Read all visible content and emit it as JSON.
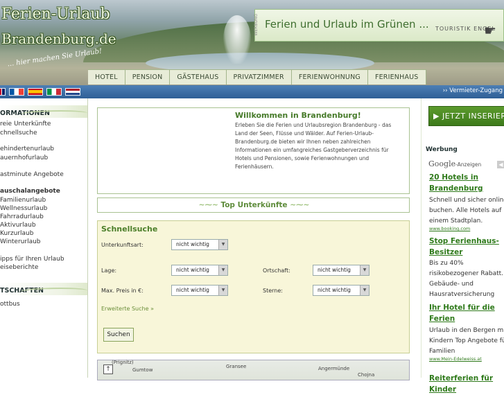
{
  "header": {
    "logo_line1": "Ferien-Urlaub",
    "logo_line2": "Brandenburg.de",
    "slogan": "... hier machen Sie Urlaub!",
    "banner_text": "Ferien und Urlaub im Grünen ...",
    "banner_brand": "TOURISTIK ENGEL",
    "banner_vertical": "WERBUNG"
  },
  "nav": [
    "HOTEL",
    "PENSION",
    "GÄSTEHAUS",
    "PRIVATZIMMER",
    "FERIENWOHNUNG",
    "FERIENHAUS"
  ],
  "langbar": {
    "vermieter": "›› Vermieter-Zugang",
    "flags": [
      "english",
      "french",
      "spanish",
      "italian",
      "dutch"
    ]
  },
  "leftnav": {
    "section_info": "ORMATIONEN",
    "items1": [
      "reie Unterkünfte",
      "chnellsuche"
    ],
    "items2": [
      "ehindertenurlaub",
      "auernhofurlaub"
    ],
    "item3": "astminute Angebote",
    "item_bold": "auschalangebote",
    "items4": [
      "Familienurlaub",
      "Wellnessurlaub",
      "Fahrradurlaub",
      "Aktivurlaub",
      "Kurzurlaub",
      "Winterurlaub"
    ],
    "items5": [
      "ipps für Ihren Urlaub",
      "eiseberichte"
    ],
    "section_places": "TSCHAFTEN",
    "items6": [
      "ottbus"
    ]
  },
  "welcome": {
    "title": "Willkommen in Brandenburg!",
    "body": "Erleben Sie die Ferien und Urlaubsregion Brandenburg - das Land der Seen, Flüsse und Wälder. Auf Ferien-Urlaub-Brandenburg.de bieten wir Ihnen neben zahlreichen Informationen ein umfangreiches Gastgeberverzeichnis für Hotels und Pensionen, sowie Ferienwohnungen und Ferienhäusern."
  },
  "top_unterkuenfte": "Top Unterkünfte",
  "search": {
    "title": "Schnellsuche",
    "label_art": "Unterkunftsart:",
    "label_lage": "Lage:",
    "label_ortschaft": "Ortschaft:",
    "label_preis": "Max. Preis in €:",
    "label_sterne": "Sterne:",
    "select_value": "nicht wichtig",
    "extended": "Erweiterte Suche »",
    "button": "Suchen"
  },
  "map": {
    "labels": [
      "(Prignitz)",
      "Gumtow",
      "Gransee",
      "Angermünde",
      "Chojna"
    ],
    "zoom_icon": "↑"
  },
  "rightcol": {
    "inserieren": "JETZT INSERIEREN",
    "werbung": "Werbung",
    "google": "Google",
    "google_suffix": "-Anzeigen",
    "ads": [
      {
        "title": [
          "20 Hotels in",
          "Brandenburg"
        ],
        "text": [
          "Schnell und sicher online",
          "buchen. Alle Hotels auf",
          "einem Stadtplan."
        ],
        "url": "www.booking.com"
      },
      {
        "title": [
          "Stop Ferienhaus-",
          "Besitzer"
        ],
        "text": [
          "Bis zu 40%",
          "risikobezogener Rabatt.",
          "Gebäude- und",
          "Hausratversicherung"
        ],
        "url": ""
      },
      {
        "title": [
          "Ihr Hotel für die",
          "Ferien"
        ],
        "text": [
          "Urlaub in den Bergen mit",
          "Kindern Top Angebote für",
          "Familien"
        ],
        "url": "www.Mein-Edelweiss.at"
      }
    ],
    "ad4_title": "Reiterferien für Kinder"
  },
  "colors": {
    "accent_green": "#4c7f2a",
    "langbar_blue": "#2f5f96",
    "search_bg": "#f8f6d9"
  }
}
